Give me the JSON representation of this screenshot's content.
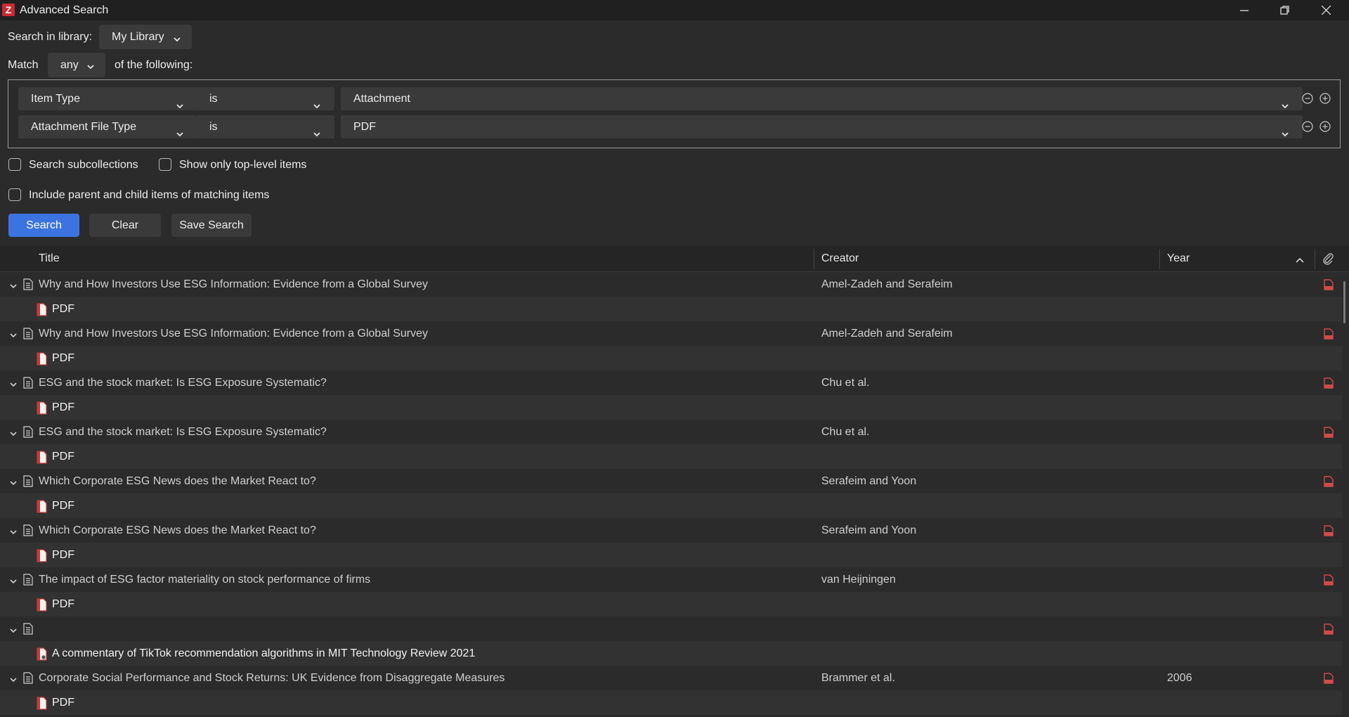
{
  "window": {
    "title": "Advanced Search",
    "logo_letter": "Z"
  },
  "search": {
    "library_label": "Search in library:",
    "library_value": "My Library",
    "match_label": "Match",
    "match_value": "any",
    "match_suffix": "of the following:"
  },
  "conditions": [
    {
      "field": "Item Type",
      "operator": "is",
      "value": "Attachment"
    },
    {
      "field": "Attachment File Type",
      "operator": "is",
      "value": "PDF"
    }
  ],
  "options": {
    "search_subcollections": "Search subcollections",
    "show_top_level": "Show only top-level items",
    "include_parent_child": "Include parent and child items of matching items"
  },
  "buttons": {
    "search": "Search",
    "clear": "Clear",
    "save_search": "Save Search"
  },
  "table": {
    "columns": {
      "title": "Title",
      "creator": "Creator",
      "year": "Year"
    },
    "rows": [
      {
        "type": "parent",
        "title": "Why and How Investors Use ESG Information: Evidence from a Global Survey",
        "creator": "Amel-Zadeh and Serafeim",
        "year": ""
      },
      {
        "type": "child",
        "title": "PDF"
      },
      {
        "type": "parent",
        "title": "Why and How Investors Use ESG Information: Evidence from a Global Survey",
        "creator": "Amel-Zadeh and Serafeim",
        "year": ""
      },
      {
        "type": "child",
        "title": "PDF"
      },
      {
        "type": "parent",
        "title": "ESG and the stock market: Is ESG Exposure Systematic?",
        "creator": "Chu et al.",
        "year": ""
      },
      {
        "type": "child",
        "title": "PDF"
      },
      {
        "type": "parent",
        "title": "ESG and the stock market: Is ESG Exposure Systematic?",
        "creator": "Chu et al.",
        "year": ""
      },
      {
        "type": "child",
        "title": "PDF"
      },
      {
        "type": "parent",
        "title": "Which Corporate ESG News does the Market React to?",
        "creator": "Serafeim and Yoon",
        "year": ""
      },
      {
        "type": "child",
        "title": "PDF"
      },
      {
        "type": "parent",
        "title": "Which Corporate ESG News does the Market React to?",
        "creator": "Serafeim and Yoon",
        "year": ""
      },
      {
        "type": "child",
        "title": "PDF"
      },
      {
        "type": "parent",
        "title": "The impact of ESG factor materiality on stock performance of firms",
        "creator": "van Heijningen",
        "year": ""
      },
      {
        "type": "child",
        "title": "PDF"
      },
      {
        "type": "parent",
        "title": "",
        "creator": "",
        "year": ""
      },
      {
        "type": "child",
        "title": "A commentary of TikTok recommendation algorithms in MIT Technology Review 2021",
        "linked": true
      },
      {
        "type": "parent",
        "title": "Corporate Social Performance and Stock Returns: UK Evidence from Disaggregate Measures",
        "creator": "Brammer et al.",
        "year": "2006"
      },
      {
        "type": "child",
        "title": "PDF"
      }
    ]
  }
}
